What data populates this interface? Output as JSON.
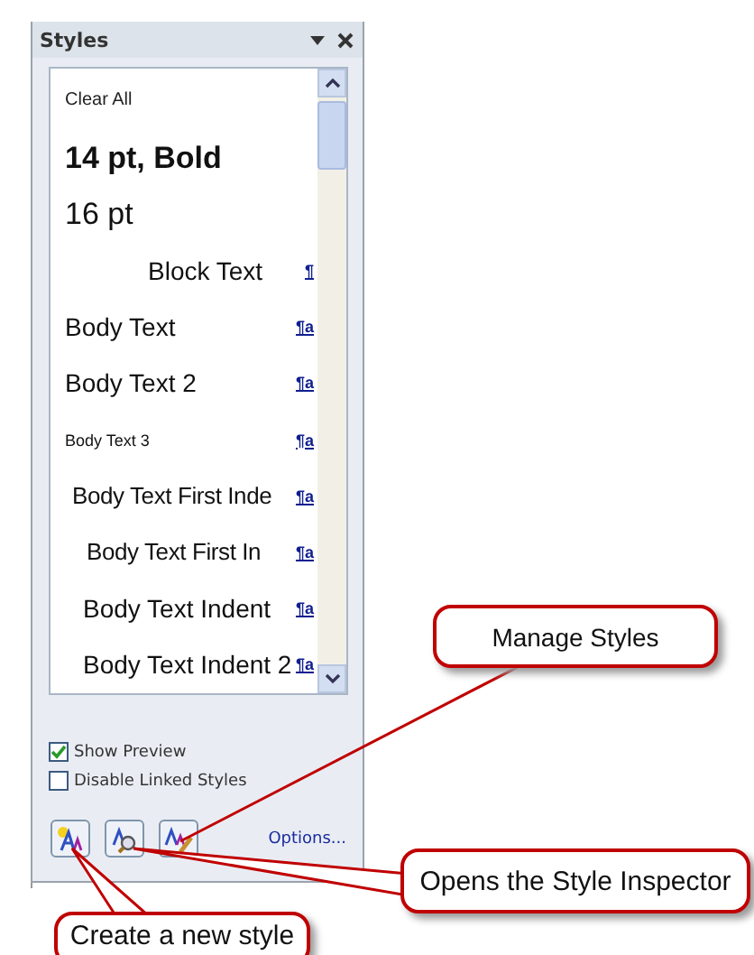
{
  "panel": {
    "title": "Styles",
    "styles": [
      {
        "text": "Clear All",
        "kind": "clear"
      },
      {
        "text": "14 pt, Bold",
        "kind": "bold"
      },
      {
        "text": "16 pt",
        "kind": "large"
      },
      {
        "text": "Block Text",
        "kind": "block",
        "mark": "¶"
      },
      {
        "text": "Body Text",
        "kind": "body",
        "mark": "¶a"
      },
      {
        "text": "Body Text 2",
        "kind": "body",
        "mark": "¶a"
      },
      {
        "text": "Body Text 3",
        "kind": "small",
        "mark": "¶a"
      },
      {
        "text": "Body Text First Inde",
        "kind": "first-indent",
        "mark": "¶a"
      },
      {
        "text": "Body Text First In",
        "kind": "first-indent-2",
        "mark": "¶a"
      },
      {
        "text": "Body Text Indent",
        "kind": "indent",
        "mark": "¶a"
      },
      {
        "text": "Body Text Indent 2",
        "kind": "indent",
        "mark": "¶a"
      }
    ],
    "options": [
      {
        "label": "Show Preview",
        "checked": true
      },
      {
        "label": "Disable Linked Styles",
        "checked": false
      }
    ],
    "options_link": "Options..."
  },
  "callouts": [
    {
      "text": "Manage Styles",
      "kind": "manage"
    },
    {
      "text": "Opens the Style Inspector",
      "kind": "inspector"
    },
    {
      "text": "Create a new style",
      "kind": "create"
    }
  ]
}
